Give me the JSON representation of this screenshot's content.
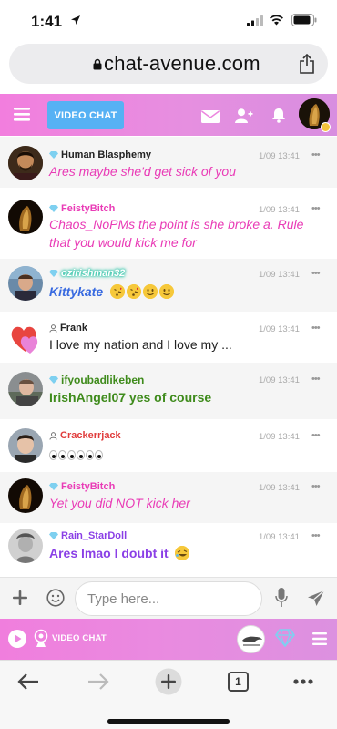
{
  "status_bar": {
    "time": "1:41"
  },
  "browser": {
    "url": "chat-avenue.com",
    "tab_count": "1"
  },
  "header": {
    "video_chat_label": "VIDEO CHAT"
  },
  "messages": [
    {
      "name": "Human Blasphemy",
      "name_color": "#222222",
      "time": "1/09 13:41",
      "text": "Ares maybe she'd get sick of you"
    },
    {
      "name": "FeistyBitch",
      "name_color": "#e93bb6",
      "time": "1/09 13:41",
      "text": "Chaos_NoPMs the point is she broke a. Rule that you would kick me for"
    },
    {
      "name": "ozirishman32",
      "name_color": "#7fd6c8",
      "time": "1/09 13:41",
      "text": "Kittykate"
    },
    {
      "name": "Frank",
      "name_color": "#222222",
      "time": "1/09 13:41",
      "text": "I love my nation and I love my ..."
    },
    {
      "name": "ifyoubadlikeben",
      "name_color": "#3f8b1c",
      "time": "1/09 13:41",
      "text": "IrishAngel07 yes of course"
    },
    {
      "name": "Crackerrjack",
      "name_color": "#e03c3c",
      "time": "1/09 13:41",
      "text": ""
    },
    {
      "name": "FeistyBitch",
      "name_color": "#e93bb6",
      "time": "1/09 13:41",
      "text": "Yet you did NOT kick her"
    },
    {
      "name": "Rain_StarDoll",
      "name_color": "#8a3fe6",
      "time": "1/09 13:41",
      "text": "Ares lmao I doubt it"
    }
  ],
  "more_glyph": "•••",
  "composer": {
    "placeholder": "Type here..."
  },
  "footer": {
    "video_chat_label": "VIDEO CHAT"
  },
  "colors": {
    "header_pink": "#f27ede",
    "button_blue": "#56b1f4",
    "rank_gem": "#7ed0f0"
  },
  "icons": [
    "location-arrow-icon",
    "signal-icon",
    "wifi-icon",
    "battery-icon",
    "lock-icon",
    "share-icon",
    "hamburger-icon",
    "mail-icon",
    "add-user-icon",
    "bell-icon",
    "plus-icon",
    "smile-icon",
    "mic-icon",
    "send-icon",
    "play-icon",
    "webcam-icon",
    "gem-icon",
    "back-icon",
    "forward-icon",
    "new-tab-icon",
    "more-icon"
  ]
}
